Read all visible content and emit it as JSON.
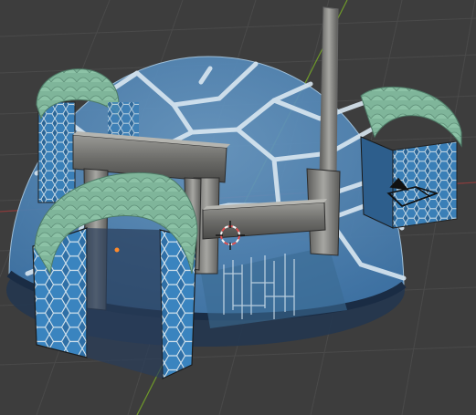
{
  "viewport": {
    "background": "#3d3d3d",
    "grid_color": "#4a4a4a",
    "x_axis_color": "#8a3b3b",
    "y_axis_color": "#6f9a2a"
  },
  "scene": {
    "dome_glass_color": "#4f86b8",
    "tile_color": "#2f6fa6",
    "tile_line_color": "#d8e6ee",
    "canopy_color": "#7fb59a",
    "metal_color": "#8a8a88",
    "floor_color": "#1d2a44"
  },
  "overlays": {
    "cursor_icon": "3d-cursor-icon",
    "camera_icon": "camera-object-icon",
    "origin_icon": "object-origin-icon"
  }
}
